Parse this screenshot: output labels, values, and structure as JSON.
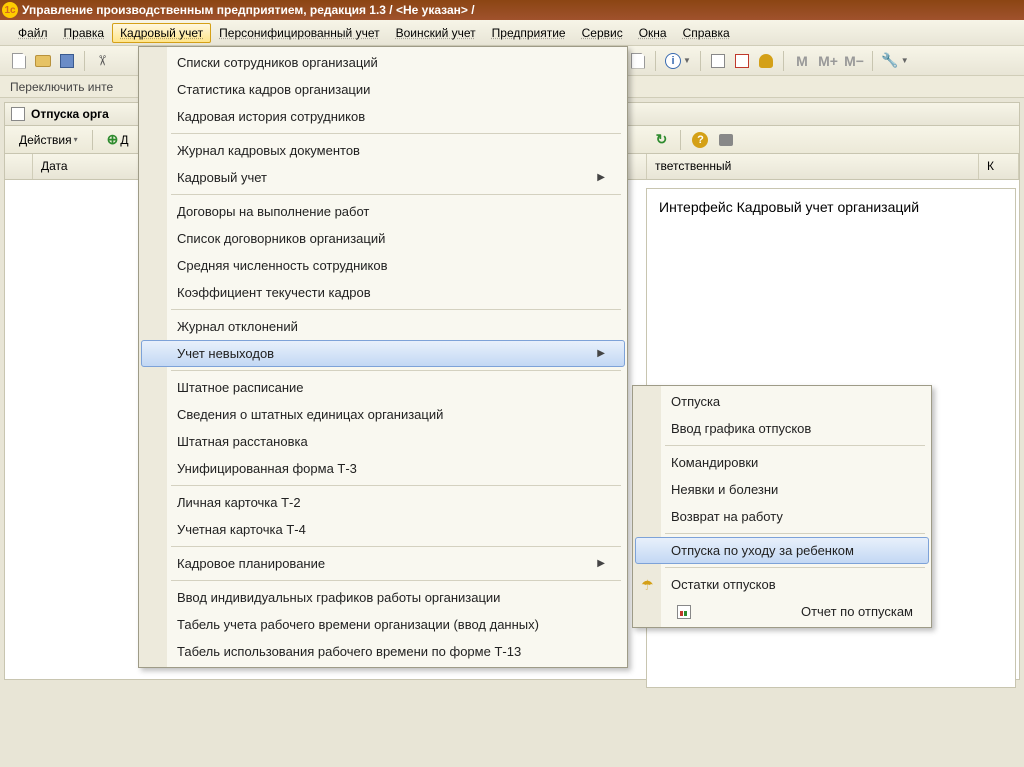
{
  "title": "Управление производственным предприятием, редакция 1.3 /  <Не указан> /",
  "menu": {
    "file": "Файл",
    "edit": "Правка",
    "hr": "Кадровый учет",
    "pers": "Персонифицированный учет",
    "mil": "Воинский учет",
    "ent": "Предприятие",
    "svc": "Сервис",
    "win": "Окна",
    "help": "Справка"
  },
  "switch_label": "Переключить инте",
  "doc": {
    "title": "Отпуска орга",
    "actions": "Действия",
    "add": "Д",
    "col_date": "Дата",
    "col_resp": "тветственный",
    "col_k": "К"
  },
  "side_text": "Интерфейс Кадровый учет организаций",
  "dropdown": {
    "i1": "Списки сотрудников организаций",
    "i2": "Статистика кадров организации",
    "i3": "Кадровая история сотрудников",
    "i4": "Журнал кадровых документов",
    "i5": "Кадровый учет",
    "i6": "Договоры на выполнение работ",
    "i7": "Список договорников организаций",
    "i8": "Средняя численность сотрудников",
    "i9": "Коэффициент текучести кадров",
    "i10": "Журнал отклонений",
    "i11": "Учет невыходов",
    "i12": "Штатное расписание",
    "i13": "Сведения о штатных единицах организаций",
    "i14": "Штатная расстановка",
    "i15": "Унифицированная форма Т-3",
    "i16": "Личная карточка Т-2",
    "i17": "Учетная карточка Т-4",
    "i18": "Кадровое планирование",
    "i19": "Ввод индивидуальных графиков работы организации",
    "i20": "Табель учета рабочего времени организации (ввод данных)",
    "i21": "Табель использования рабочего времени по форме Т-13"
  },
  "submenu": {
    "s1": "Отпуска",
    "s2": "Ввод графика отпусков",
    "s3": "Командировки",
    "s4": "Неявки и болезни",
    "s5": "Возврат на работу",
    "s6": "Отпуска по уходу за ребенком",
    "s7": "Остатки отпусков",
    "s8": "Отчет по отпускам"
  },
  "m_buttons": {
    "m": "M",
    "mplus": "M+",
    "mminus": "M−"
  }
}
